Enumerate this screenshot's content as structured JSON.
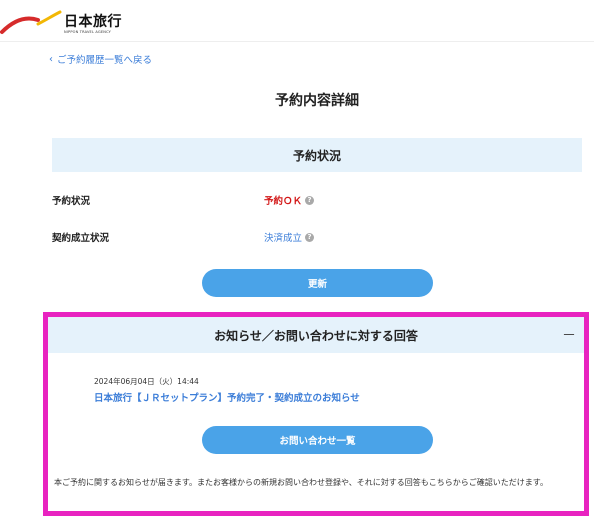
{
  "header": {
    "logo_text": "日本旅行",
    "logo_subtext": "NIPPON TRAVEL AGENCY",
    "logo_icon": "logo-swoosh"
  },
  "back_link": {
    "icon": "chevron-left-icon",
    "label": "ご予約履歴一覧へ戻る"
  },
  "page_title": "予約内容詳細",
  "status_section": {
    "title": "予約状況",
    "rows": [
      {
        "label": "予約状況",
        "value": "予約ＯＫ",
        "color": "#d31818",
        "help_icon": "?"
      },
      {
        "label": "契約成立状況",
        "value": "決済成立",
        "color": "#3b7dd8",
        "help_icon": "?"
      }
    ],
    "update_button": "更新"
  },
  "notice_section": {
    "title": "お知らせ／お問い合わせに対する回答",
    "collapse_icon": "－",
    "items": [
      {
        "date": "2024年06月04日（火）14:44",
        "title": "日本旅行【ＪＲセットプラン】予約完了・契約成立のお知らせ"
      }
    ],
    "inquiry_button": "お問い合わせ一覧",
    "description": "本ご予約に関するお知らせが届きます。またお客様からの新規お問い合わせ登録や、それに対する回答もこちらからご確認いただけます。"
  },
  "colors": {
    "accent": "#4aa3e8",
    "section_bg": "#e5f2fb",
    "link": "#3b7dd8",
    "ok_red": "#d31818",
    "highlight_border": "#e823c0"
  }
}
